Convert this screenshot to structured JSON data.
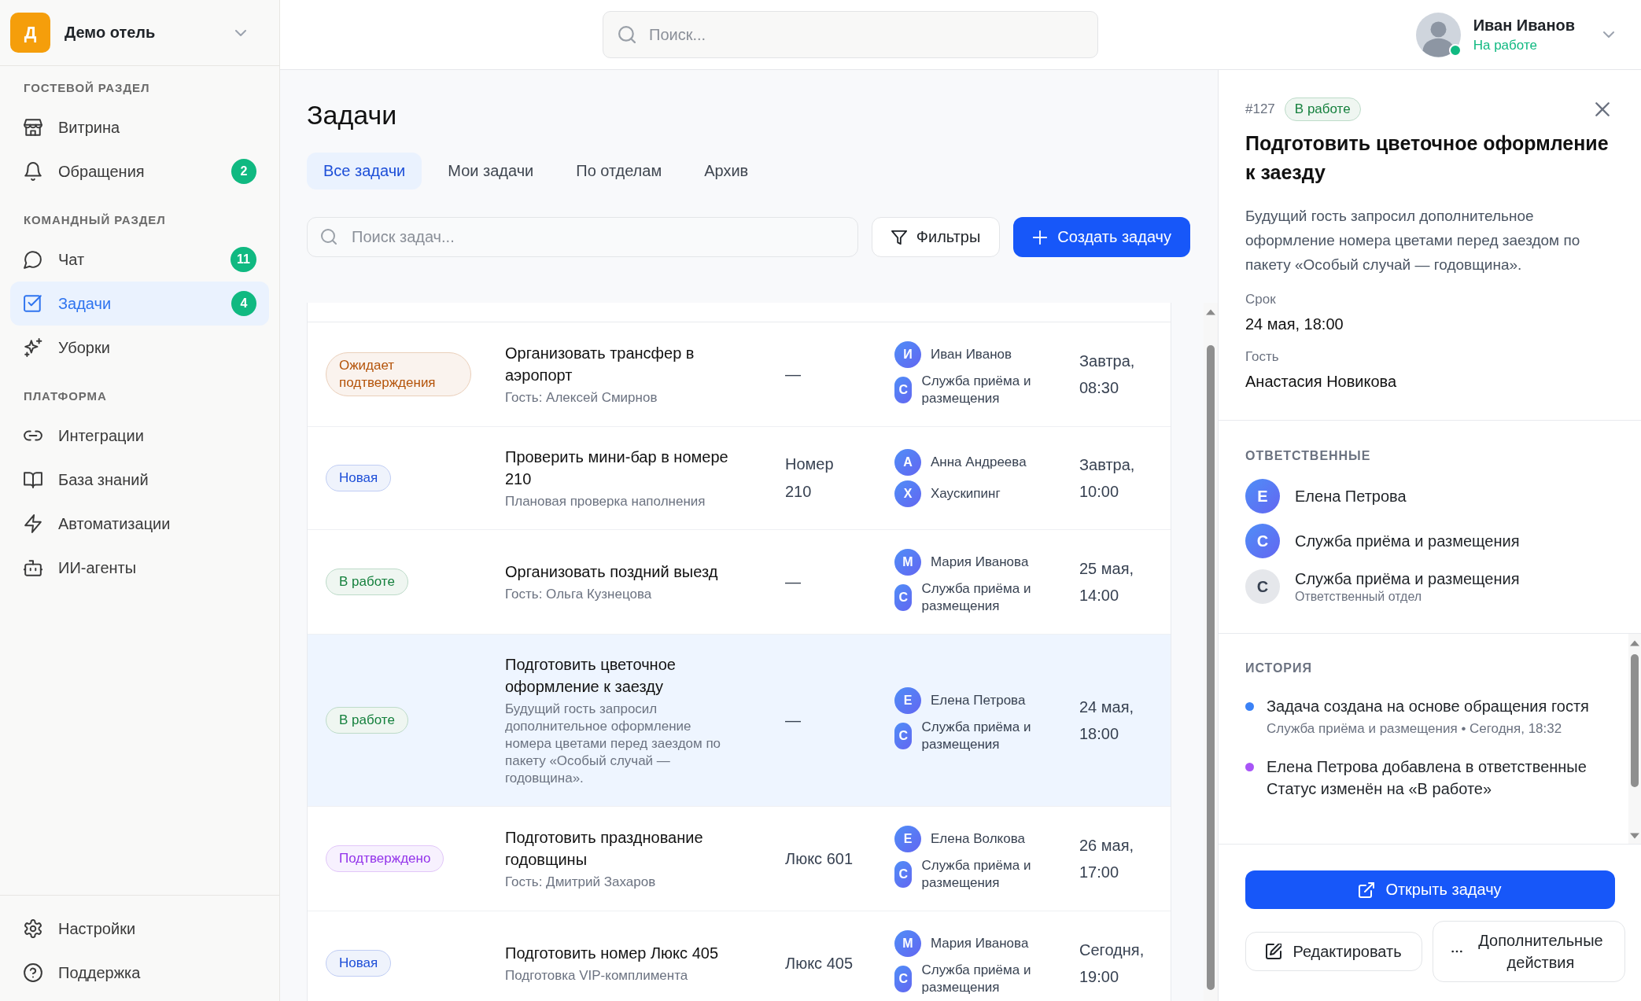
{
  "workspace": {
    "initial": "Д",
    "name": "Демо отель"
  },
  "sidebar": {
    "sections": [
      {
        "title": "ГОСТЕВОЙ РАЗДЕЛ",
        "items": [
          {
            "label": "Витрина",
            "selected": false
          },
          {
            "label": "Обращения",
            "selected": false,
            "badge": "2"
          }
        ]
      },
      {
        "title": "КОМАНДНЫЙ РАЗДЕЛ",
        "items": [
          {
            "label": "Чат",
            "selected": false,
            "badge": "11"
          },
          {
            "label": "Задачи",
            "selected": true,
            "badge": "4"
          },
          {
            "label": "Уборки",
            "selected": false
          }
        ]
      },
      {
        "title": "ПЛАТФОРМА",
        "items": [
          {
            "label": "Интеграции",
            "selected": false
          },
          {
            "label": "База знаний",
            "selected": false
          },
          {
            "label": "Автоматизации",
            "selected": false
          },
          {
            "label": "ИИ-агенты",
            "selected": false
          }
        ]
      }
    ],
    "footer": [
      {
        "label": "Настройки",
        "selected": false
      },
      {
        "label": "Поддержка",
        "selected": false
      }
    ]
  },
  "topbar": {
    "search": {
      "placeholder": "Поиск..."
    },
    "user": {
      "name": "Иван Иванов",
      "status": "На работе",
      "online": true
    }
  },
  "page": {
    "title": "Задачи",
    "tabs": [
      {
        "label": "Все задачи",
        "selected": true
      },
      {
        "label": "Мои задачи",
        "selected": false
      },
      {
        "label": "По отделам",
        "selected": false
      },
      {
        "label": "Архив",
        "selected": false
      }
    ],
    "search": {
      "placeholder": "Поиск задач..."
    },
    "buttons": [
      {
        "kind": "secondary",
        "label": "Фильтры"
      },
      {
        "kind": "primary",
        "label": "Создать задачу"
      }
    ]
  },
  "table": {
    "rows": [
      {
        "status": {
          "label": "Ожидает подтверждения",
          "color": "#b45309"
        },
        "title": "Организовать трансфер в аэропорт",
        "subtitle": "Гость: Алексей Смирнов",
        "room": "—",
        "assignees": [
          {
            "initial": "И",
            "name": "Иван Иванов"
          },
          {
            "initial": "С",
            "name": "Служба приёма и размещения"
          }
        ],
        "deadline": "Завтра, 08:30",
        "selected": false
      },
      {
        "status": {
          "label": "Новая",
          "color": "#1d4ed8"
        },
        "title": "Проверить мини-бар в номере 210",
        "subtitle": "Плановая проверка наполнения",
        "room": "Номер 210",
        "assignees": [
          {
            "initial": "А",
            "name": "Анна Андреева"
          },
          {
            "initial": "Х",
            "name": "Хаускипинг"
          }
        ],
        "deadline": "Завтра, 10:00",
        "selected": false
      },
      {
        "status": {
          "label": "В работе",
          "color": "#15803d"
        },
        "title": "Организовать поздний выезд",
        "subtitle": "Гость: Ольга Кузнецова",
        "room": "—",
        "assignees": [
          {
            "initial": "М",
            "name": "Мария Иванова"
          },
          {
            "initial": "С",
            "name": "Служба приёма и размещения"
          }
        ],
        "deadline": "25 мая, 14:00",
        "selected": false
      },
      {
        "status": {
          "label": "В работе",
          "color": "#15803d"
        },
        "title": "Подготовить цветочное оформление к заезду",
        "subtitle": "Будущий гость запросил дополнительное оформление номера цветами перед заездом по пакету «Особый случай — годовщина».",
        "room": "—",
        "assignees": [
          {
            "initial": "Е",
            "name": "Елена Петрова"
          },
          {
            "initial": "С",
            "name": "Служба приёма и размещения"
          }
        ],
        "deadline": "24 мая, 18:00",
        "selected": true
      },
      {
        "status": {
          "label": "Подтверждено",
          "color": "#9333ea"
        },
        "title": "Подготовить празднование годовщины",
        "subtitle": "Гость: Дмитрий Захаров",
        "room": "Люкс 601",
        "assignees": [
          {
            "initial": "Е",
            "name": "Елена Волкова"
          },
          {
            "initial": "С",
            "name": "Служба приёма и размещения"
          }
        ],
        "deadline": "26 мая, 17:00",
        "selected": false
      },
      {
        "status": {
          "label": "Новая",
          "color": "#1d4ed8"
        },
        "title": "Подготовить номер Люкс 405",
        "subtitle": "Подготовка VIP-комплимента",
        "room": "Люкс 405",
        "assignees": [
          {
            "initial": "М",
            "name": "Мария Иванова"
          },
          {
            "initial": "С",
            "name": "Служба приёма и размещения"
          }
        ],
        "deadline": "Сегодня, 19:00",
        "selected": false
      }
    ]
  },
  "detail": {
    "number": "#127",
    "status": {
      "label": "В работе",
      "color": "#15803d"
    },
    "title": "Подготовить цветочное оформление к заезду",
    "description": "Будущий гость запросил дополнительное оформление номера цветами перед заездом по пакету «Особый случай — годовщина».",
    "fields": [
      {
        "label": "Срок",
        "value": "24 мая, 18:00"
      },
      {
        "label": "Гость",
        "value": "Анастасия Новикова"
      }
    ],
    "assignees_title": "ОТВЕТСТВЕННЫЕ",
    "assignees": [
      {
        "kind": "person",
        "initial": "Е",
        "name": "Елена Петрова"
      },
      {
        "kind": "person",
        "initial": "С",
        "name": "Служба приёма и размещения"
      },
      {
        "kind": "department",
        "initial": "С",
        "name": "Служба приёма и размещения",
        "note": "Ответственный отдел"
      }
    ],
    "history_title": "ИСТОРИЯ",
    "history": [
      {
        "text": "Задача создана на основе обращения гостя",
        "meta": "Служба приёма и размещения • Сегодня, 18:32",
        "color": "#3b82f6"
      },
      {
        "text": "Елена Петрова добавлена в ответственные Статус изменён на «В работе»",
        "color": "#a855f7"
      }
    ],
    "actions": [
      {
        "kind": "primary",
        "label": "Открыть задачу"
      },
      {
        "kind": "secondary",
        "label": "Редактировать"
      },
      {
        "kind": "secondary",
        "label": "Дополнительные действия"
      }
    ]
  }
}
